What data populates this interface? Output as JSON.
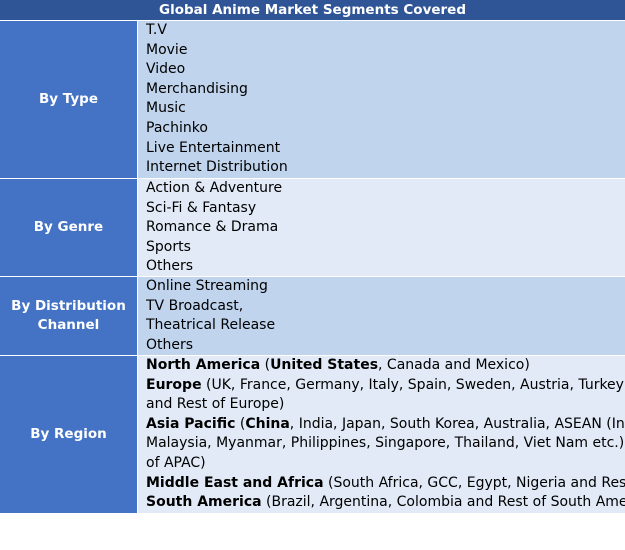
{
  "title": "Global Anime Market Segments Covered",
  "sections": [
    {
      "label": "By Type",
      "items": [
        "T.V",
        "Movie",
        "Video",
        "Merchandising",
        "Music",
        "Pachinko",
        "Live Entertainment",
        "Internet Distribution"
      ]
    },
    {
      "label": "By Genre",
      "items": [
        "Action & Adventure",
        "Sci-Fi & Fantasy",
        "Romance & Drama",
        "Sports",
        "Others"
      ]
    },
    {
      "label_line1": "By Distribution",
      "label_line2": "Channel",
      "items": [
        "Online Streaming",
        "TV Broadcast,",
        "Theatrical Release",
        "Others"
      ]
    },
    {
      "label": "By Region",
      "lines": [
        {
          "bold": "North America",
          "mid": " (",
          "bold2": "United States",
          "rest": ", Canada and Mexico)"
        },
        {
          "bold": "Europe",
          "rest": " (UK, France, Germany, Italy, Spain, Sweden, Austria, Turkey, Russi"
        },
        {
          "rest": "and Rest of Europe)"
        },
        {
          "bold": "Asia Pacific",
          "mid": " (",
          "bold2": "China",
          "rest": ", India, Japan, South Korea, Australia, ASEAN (Indonesia"
        },
        {
          "rest": "Malaysia, Myanmar, Philippines, Singapore, Thailand, Viet Nam etc.) and"
        },
        {
          "rest": "of APAC)"
        },
        {
          "bold": "Middle East and Africa",
          "rest": " (South Africa, GCC, Egypt, Nigeria and Rest of ME"
        },
        {
          "bold": "South America",
          "rest": " (Brazil, Argentina, Colombia and Rest of South America)"
        }
      ]
    }
  ]
}
